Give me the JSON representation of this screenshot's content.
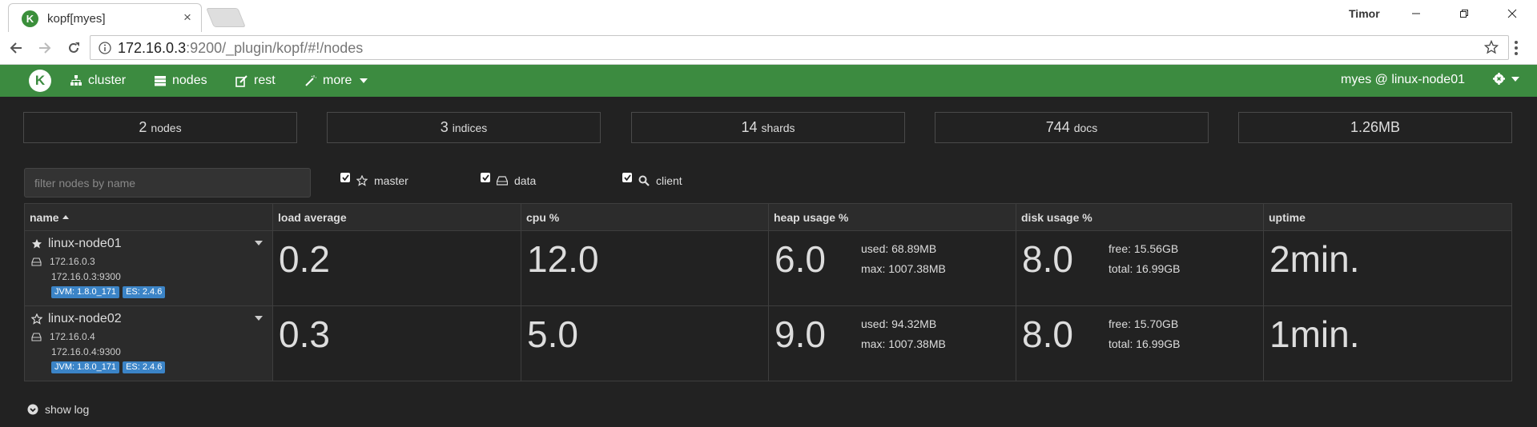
{
  "browser": {
    "tab_title": "kopf[myes]",
    "favicon_letter": "K",
    "profile_name": "Timor",
    "url_host": "172.16.0.3",
    "url_rest": ":9200/_plugin/kopf/#!/nodes"
  },
  "navbar": {
    "brand_letter": "K",
    "cluster_label": "cluster",
    "nodes_label": "nodes",
    "rest_label": "rest",
    "more_label": "more",
    "user_label": "myes @ linux-node01"
  },
  "summary": {
    "nodes": {
      "value": "2",
      "unit": "nodes"
    },
    "indices": {
      "value": "3",
      "unit": "indices"
    },
    "shards": {
      "value": "14",
      "unit": "shards"
    },
    "docs": {
      "value": "744",
      "unit": "docs"
    },
    "size": {
      "value": "1.26MB"
    }
  },
  "filters": {
    "placeholder": "filter nodes by name",
    "master_label": "master",
    "data_label": "data",
    "client_label": "client"
  },
  "table": {
    "headers": {
      "name": "name",
      "load": "load average",
      "cpu": "cpu %",
      "heap": "heap usage %",
      "disk": "disk usage %",
      "uptime": "uptime"
    },
    "rows": [
      {
        "name": "linux-node01",
        "ip": "172.16.0.3",
        "address": "172.16.0.3:9300",
        "jvm": "JVM: 1.8.0_171",
        "es": "ES: 2.4.6",
        "load": "0.2",
        "cpu": "12.0",
        "heap": "6.0",
        "heap_used": "used: 68.89MB",
        "heap_max": "max: 1007.38MB",
        "disk": "8.0",
        "disk_free": "free: 15.56GB",
        "disk_total": "total: 16.99GB",
        "uptime": "2min."
      },
      {
        "name": "linux-node02",
        "ip": "172.16.0.4",
        "address": "172.16.0.4:9300",
        "jvm": "JVM: 1.8.0_171",
        "es": "ES: 2.4.6",
        "load": "0.3",
        "cpu": "5.0",
        "heap": "9.0",
        "heap_used": "used: 94.32MB",
        "heap_max": "max: 1007.38MB",
        "disk": "8.0",
        "disk_free": "free: 15.70GB",
        "disk_total": "total: 16.99GB",
        "uptime": "1min."
      }
    ]
  },
  "footer": {
    "show_log_label": "show log"
  },
  "colors": {
    "navbar": "#3c8b40",
    "background": "#222222",
    "badge": "#3b84c7"
  }
}
